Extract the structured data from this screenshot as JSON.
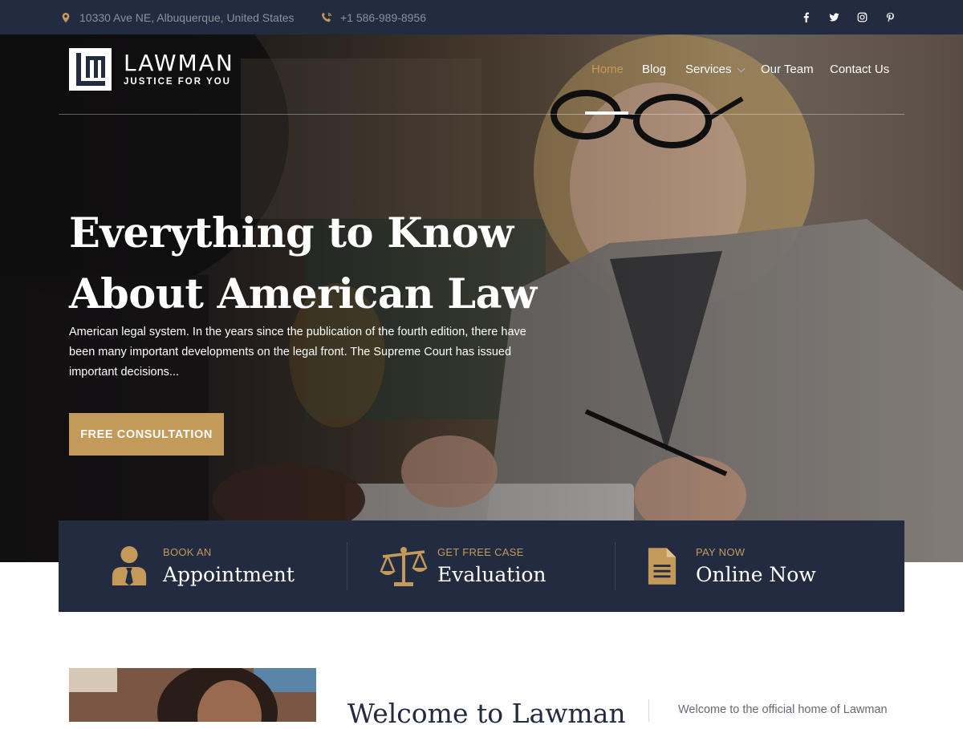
{
  "topbar": {
    "address": "10330 Ave NE, Albuquerque, United States",
    "phone": "+1 586-989-8956",
    "social": [
      "facebook-icon",
      "twitter-icon",
      "instagram-icon",
      "pinterest-icon"
    ]
  },
  "brand": {
    "name": "LAWMAN",
    "tagline": "JUSTICE FOR YOU",
    "accent": "#c49a5b",
    "navy": "#222b3f"
  },
  "nav": {
    "items": [
      {
        "label": "Home",
        "active": true
      },
      {
        "label": "Blog"
      },
      {
        "label": "Services",
        "dropdown": true
      },
      {
        "label": "Our Team"
      },
      {
        "label": "Contact Us"
      }
    ]
  },
  "hero": {
    "title_line1": "Everything to Know",
    "title_line2": "About American Law",
    "description": "American legal system. In the years since the publication of the fourth edition, there have been many important developments on the legal front. The Supreme Court has issued important decisions...",
    "cta_label": "FREE CONSULTATION"
  },
  "services": [
    {
      "small": "BOOK AN",
      "big": "Appointment",
      "icon": "person-icon"
    },
    {
      "small": "GET FREE CASE",
      "big": "Evaluation",
      "icon": "scales-icon"
    },
    {
      "small": "PAY NOW",
      "big": "Online Now",
      "icon": "document-icon"
    }
  ],
  "about": {
    "heading": "Welcome to Lawman",
    "side_text": "Welcome to the official home of Lawman"
  }
}
